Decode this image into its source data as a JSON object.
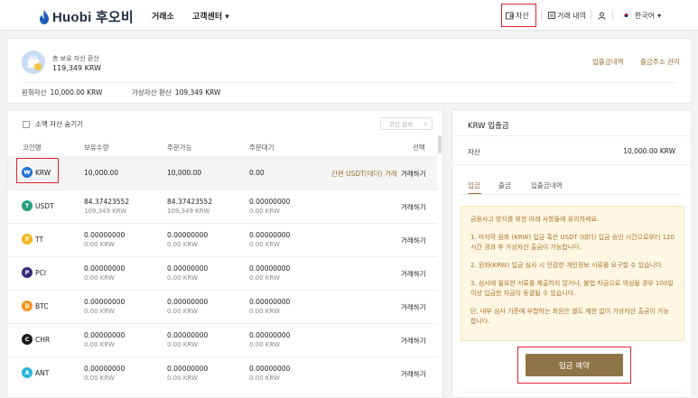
{
  "header": {
    "logo": "Huobi 후오비",
    "nav": [
      "거래소",
      "고객센터"
    ],
    "nav_caret": "▾",
    "right": {
      "assets": "자산",
      "history": "거래 내역",
      "language": "한국어",
      "lang_caret": "▾"
    }
  },
  "summary": {
    "total_label": "총 보유 자산 환산",
    "total_value": "119,349 KRW",
    "links": [
      "입출금내역",
      "출금주소 관리"
    ],
    "krw_label": "원화자산",
    "krw_value": "10,000.00 KRW",
    "virtual_label": "가상자산 환산",
    "virtual_value": "109,349 KRW"
  },
  "assets": {
    "hide_small": "소액 자산 숨기기",
    "search_placeholder": "코인 검색",
    "columns": [
      "코인명",
      "보유수량",
      "주문가능",
      "주문대기",
      "선택"
    ],
    "quick_buy": "간편 USDT(테더) 거래",
    "trade_label": "거래하기",
    "rows": [
      {
        "coin": "KRW",
        "icon": "₩",
        "color": "#1c6fd6",
        "held": "10,000.00",
        "held_sub": "",
        "avail": "10,000.00",
        "avail_sub": "",
        "pending": "0.00",
        "pending_sub": ""
      },
      {
        "coin": "USDT",
        "icon": "T",
        "color": "#26a17b",
        "held": "84.37423552",
        "held_sub": "109,349 KRW",
        "avail": "84.37423552",
        "avail_sub": "109,349 KRW",
        "pending": "0.00000000",
        "pending_sub": "0.00 KRW"
      },
      {
        "coin": "TT",
        "icon": "₮",
        "color": "#f5b81c",
        "held": "0.00000000",
        "held_sub": "0.00 KRW",
        "avail": "0.00000000",
        "avail_sub": "0.00 KRW",
        "pending": "0.00000000",
        "pending_sub": "0.00 KRW"
      },
      {
        "coin": "PCI",
        "icon": "P",
        "color": "#3a2a7a",
        "held": "0.00000000",
        "held_sub": "0.00 KRW",
        "avail": "0.00000000",
        "avail_sub": "0.00 KRW",
        "pending": "0.00000000",
        "pending_sub": "0.00 KRW"
      },
      {
        "coin": "BTC",
        "icon": "₿",
        "color": "#f7931a",
        "held": "0.00000000",
        "held_sub": "0.00 KRW",
        "avail": "0.00000000",
        "avail_sub": "0.00 KRW",
        "pending": "0.00000000",
        "pending_sub": "0.00 KRW"
      },
      {
        "coin": "CHR",
        "icon": "C",
        "color": "#1a1a1a",
        "held": "0.00000000",
        "held_sub": "0.00 KRW",
        "avail": "0.00000000",
        "avail_sub": "0.00 KRW",
        "pending": "0.00000000",
        "pending_sub": "0.00 KRW"
      },
      {
        "coin": "ANT",
        "icon": "A",
        "color": "#2bb5d8",
        "held": "0.00000000",
        "held_sub": "0.00 KRW",
        "avail": "0.00000000",
        "avail_sub": "0.00 KRW",
        "pending": "0.00000000",
        "pending_sub": "0.00 KRW"
      }
    ]
  },
  "deposit": {
    "title": "KRW  입출금",
    "asset_label": "자산",
    "asset_value": "10,000.00 KRW",
    "tabs": [
      "입금",
      "출금",
      "입출금내역"
    ],
    "notices": [
      "금융사고 방지를 위한 아래 사항들에 유의하세요.",
      "1. 마지막 원화 (KRW) 입금 혹은 USDT (테더) 입금 승인 시간으로부터 120시간 경과 후 가상자산 출금이 가능합니다.",
      "2. 원화(KRW) 입금 심사 시 인감한 개인정보 서류를 요구할 수 있습니다.",
      "3. 심사에 필요한 서류를 제출하지 않거나, 불법 자금으로 의심될 경우 100일 이상 입금한 자금이 동결될 수 있습니다.",
      "단, 내부 심사 기준에 부합하는 회원은 별도 제한 없이 가상자산 출금이 가능합니다."
    ],
    "button": "입금 예약"
  }
}
